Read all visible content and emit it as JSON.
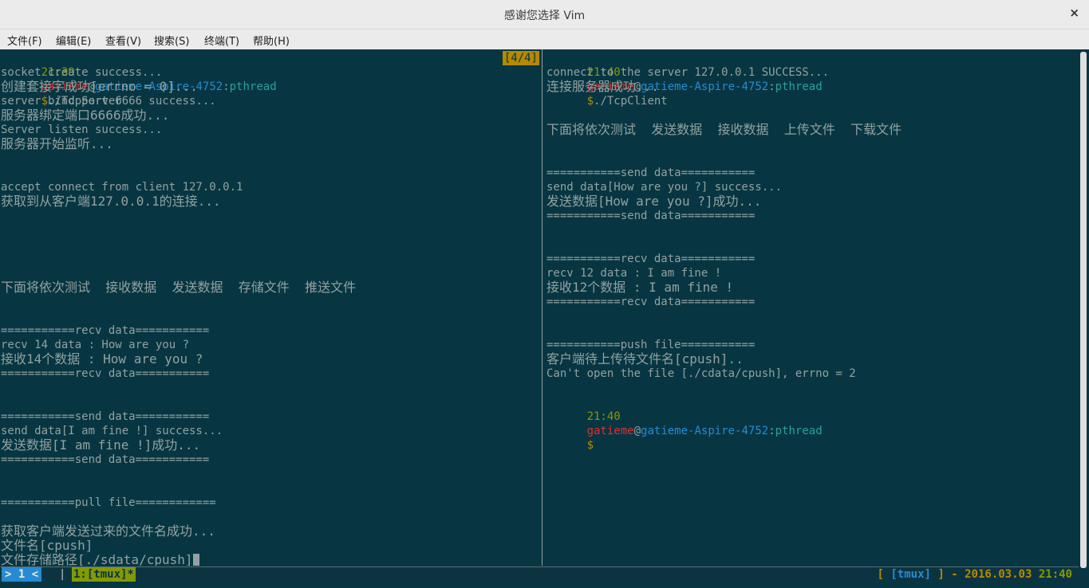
{
  "window": {
    "title": "感谢您选择 Vim",
    "close_glyph": "×"
  },
  "menu": [
    "文件(F)",
    "编辑(E)",
    "查看(V)",
    "搜索(S)",
    "终端(T)",
    "帮助(H)"
  ],
  "prompt_parts": {
    "user": "gatieme",
    "at": "@",
    "host": "gatieme-Aspire-4752",
    "colon": ":",
    "dir": "pthread",
    "dollar": "$"
  },
  "left_pane": {
    "prompt": {
      "time": "21:39",
      "command": "./TcpServer"
    },
    "pane_index": "[4/4]",
    "lines": [
      "socket create success...",
      "创建套接字成功[errno = 0]...",
      "server bind port 6666 success...",
      "服务器绑定端口6666成功...",
      "Server listen success...",
      "服务器开始监听...",
      "",
      "",
      "accept connect from client 127.0.0.1",
      "获取到从客户端127.0.0.1的连接...",
      "",
      "",
      "",
      "",
      "",
      "下面将依次测试  接收数据  发送数据  存储文件  推送文件",
      "",
      "",
      "===========recv data===========",
      "recv 14 data : How are you ?",
      "接收14个数据 : How are you ?",
      "===========recv data===========",
      "",
      "",
      "===========send data===========",
      "send data[I am fine !] success...",
      "发送数据[I am fine !]成功...",
      "===========send data===========",
      "",
      "",
      "===========pull file============",
      "",
      "获取客户端发送过来的文件名成功...",
      "文件名[cpush]",
      "文件存储路径[./sdata/cpush]"
    ]
  },
  "right_pane": {
    "prompt": {
      "time": "21:40",
      "command": "./TcpClient"
    },
    "lines": [
      "connect to the server 127.0.0.1 SUCCESS...",
      "连接服务器成功...",
      "",
      "",
      "下面将依次测试  发送数据  接收数据  上传文件  下载文件",
      "",
      "",
      "===========send data===========",
      "send data[How are you ?] success...",
      "发送数据[How are you ?]成功...",
      "===========send data===========",
      "",
      "",
      "===========recv data===========",
      "recv 12 data : I am fine !",
      "接收12个数据 : I am fine !",
      "===========recv data===========",
      "",
      "",
      "===========push file===========",
      "客户端待上传待文件名[cpush]..",
      "Can't open the file [./cdata/cpush], errno = 2"
    ],
    "final_prompt": {
      "time": "21:40",
      "command": ""
    }
  },
  "statusbar": {
    "session": "> 1 <",
    "separator": "|",
    "window": "1:[tmux]*",
    "right": {
      "open": "[ ",
      "name": "[tmux]",
      "close": " ]",
      "dash": " - ",
      "date": "2016.03.03",
      "time": "21:40"
    }
  },
  "colors": {
    "background": "#073642",
    "foreground": "#93a1a1",
    "green": "#859900",
    "red": "#dc322f",
    "blue": "#268bd2",
    "cyan": "#2aa198",
    "yellow": "#b58900"
  }
}
